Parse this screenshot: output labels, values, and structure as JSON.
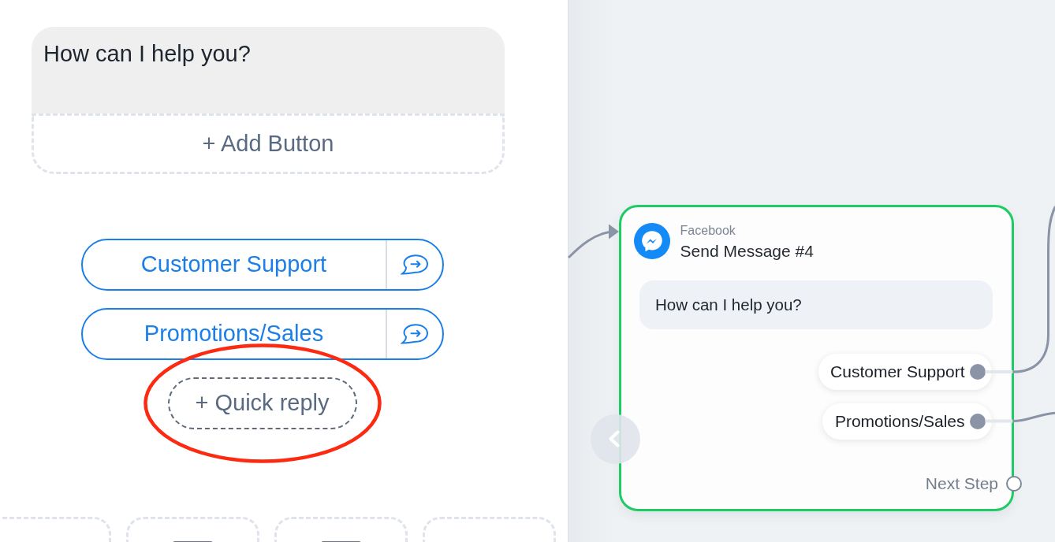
{
  "editor": {
    "message_field": {
      "value": "How can I help you?"
    },
    "add_button": {
      "label": "+ Add Button"
    },
    "quick_replies": [
      {
        "label": "Customer Support"
      },
      {
        "label": "Promotions/Sales"
      }
    ],
    "add_quick_reply": {
      "label": "+ Quick reply",
      "highlighted": true
    },
    "block_tiles": [
      {
        "kind": "blank"
      },
      {
        "kind": "icon"
      },
      {
        "kind": "icon"
      },
      {
        "kind": "blank"
      }
    ]
  },
  "canvas": {
    "node": {
      "platform": "Facebook",
      "title": "Send Message #4",
      "selected": true,
      "message": "How can I help you?",
      "buttons": [
        {
          "label": "Customer Support",
          "connected": true
        },
        {
          "label": "Promotions/Sales",
          "connected": true
        }
      ],
      "next_step": {
        "label": "Next Step",
        "connected": false
      }
    }
  }
}
